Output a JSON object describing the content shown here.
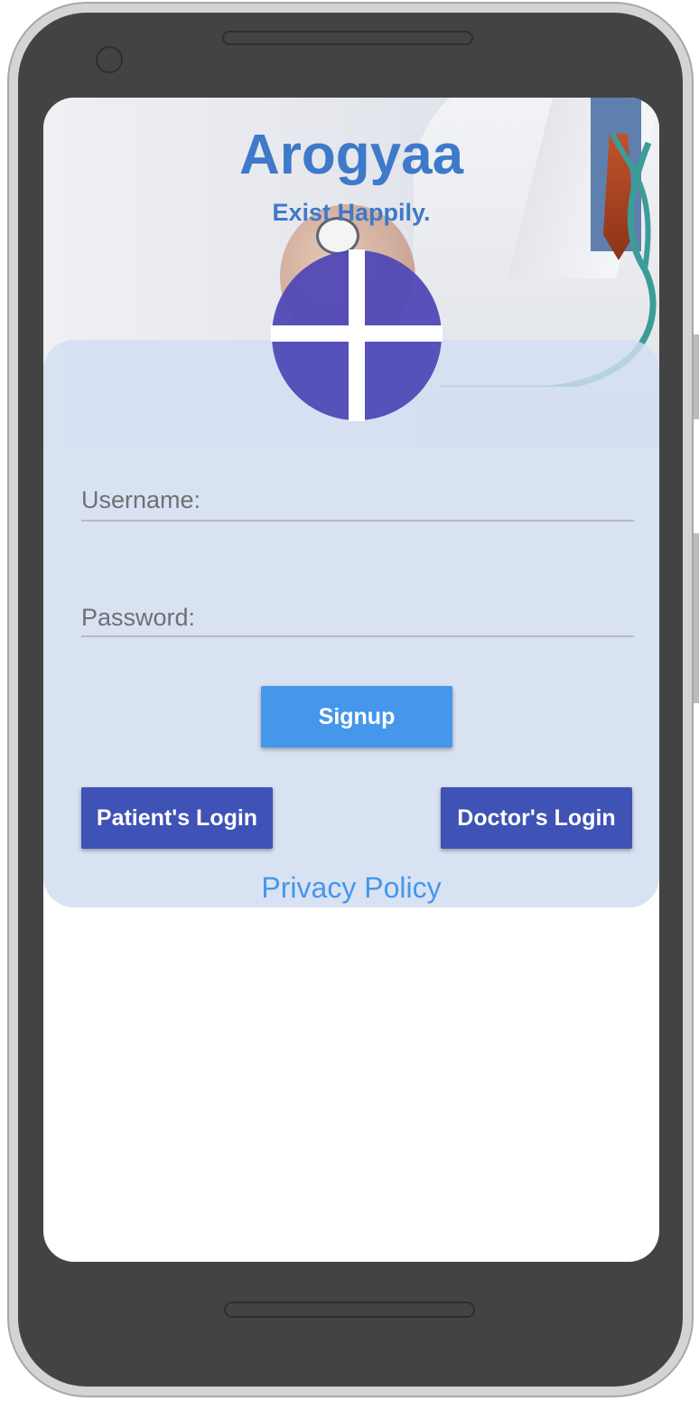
{
  "app": {
    "title": "Arogyaa",
    "tagline": "Exist Happily."
  },
  "form": {
    "username_label": "Username:",
    "password_label": "Password:"
  },
  "buttons": {
    "signup": "Signup",
    "patient_login": "Patient's Login",
    "doctor_login": "Doctor's Login"
  },
  "footer": {
    "privacy_link": "Privacy Policy"
  },
  "colors": {
    "brand_text": "#3f79c9",
    "primary_button": "#3f52b5",
    "signup_button": "#4497ea",
    "form_background": "#d9e2f3",
    "logo_circle": "#5049b6"
  },
  "icons": {
    "logo": "medical-cross-icon"
  }
}
